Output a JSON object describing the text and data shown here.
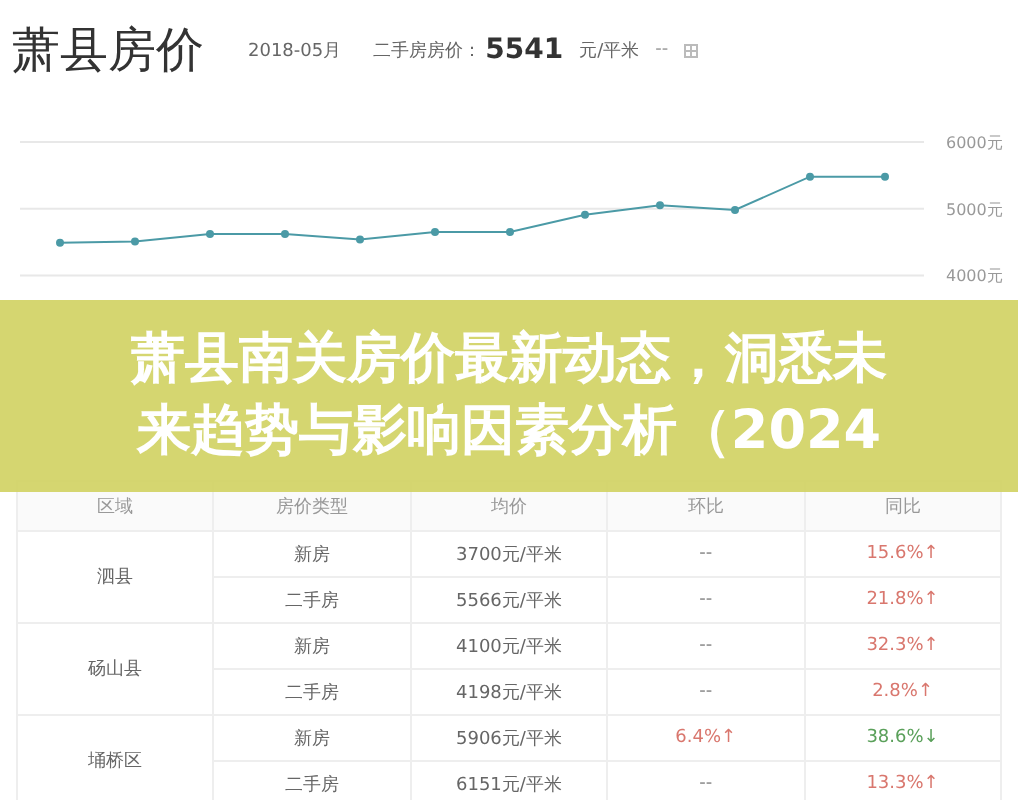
{
  "header": {
    "title": "萧县房价",
    "month": "2018-05月",
    "label": "二手房房价：",
    "price": "5541",
    "unit": "元/平米",
    "change": "--"
  },
  "chart": {
    "chart_data": {
      "type": "line",
      "series": [
        {
          "color": "#4b9aa6",
          "marker": true,
          "values": [
            4490,
            4510,
            4620,
            4620,
            4540,
            4650,
            4650,
            4910,
            5050,
            4980,
            5480,
            5480
          ]
        }
      ],
      "ylim": [
        4000,
        6000
      ],
      "yticks": [
        {
          "value": 6000,
          "label": "6000元"
        },
        {
          "value": 5000,
          "label": "5000元"
        },
        {
          "value": 4000,
          "label": "4000元"
        }
      ]
    }
  },
  "banner": {
    "title_lines": [
      "萧县南关房价最新动态，洞悉未",
      "来趋势与影响因素分析（2024"
    ]
  },
  "table": {
    "columns": [
      "区域",
      "房价类型",
      "均价",
      "环比",
      "同比"
    ],
    "regions": [
      {
        "name": "泗县",
        "rows": [
          {
            "type": "新房",
            "price": "3700元/平米",
            "mom": {
              "text": "--"
            },
            "yoy": {
              "text": "15.6%↑",
              "color": "#d9776e"
            }
          },
          {
            "type": "二手房",
            "price": "5566元/平米",
            "mom": {
              "text": "--"
            },
            "yoy": {
              "text": "21.8%↑",
              "color": "#d9776e"
            }
          }
        ]
      },
      {
        "name": "砀山县",
        "rows": [
          {
            "type": "新房",
            "price": "4100元/平米",
            "mom": {
              "text": "--"
            },
            "yoy": {
              "text": "32.3%↑",
              "color": "#d9776e"
            }
          },
          {
            "type": "二手房",
            "price": "4198元/平米",
            "mom": {
              "text": "--"
            },
            "yoy": {
              "text": "2.8%↑",
              "color": "#d9776e"
            }
          }
        ]
      },
      {
        "name": "埇桥区",
        "rows": [
          {
            "type": "新房",
            "price": "5906元/平米",
            "mom": {
              "text": "6.4%↑",
              "color": "#d9776e"
            },
            "yoy": {
              "text": "38.6%↓",
              "color": "#5aa05a"
            }
          },
          {
            "type": "二手房",
            "price": "6151元/平米",
            "mom": {
              "text": "--"
            },
            "yoy": {
              "text": "13.3%↑",
              "color": "#d9776e"
            }
          }
        ]
      }
    ]
  }
}
